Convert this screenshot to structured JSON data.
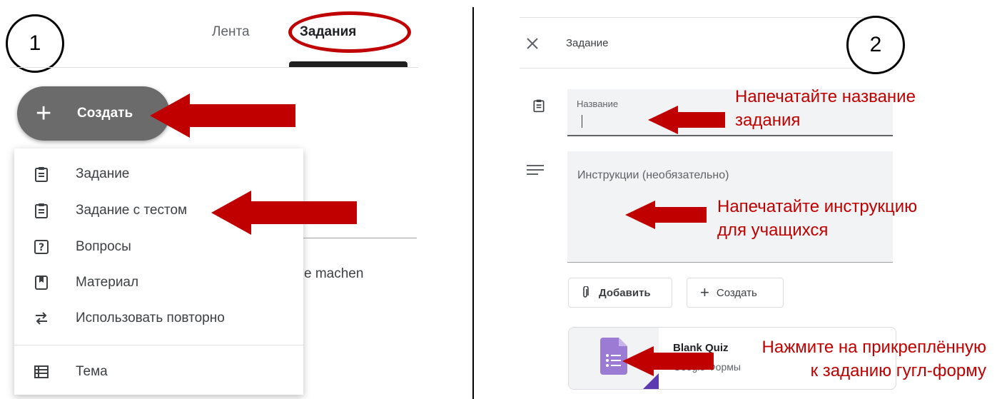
{
  "left": {
    "step_number": "1",
    "tabs": [
      {
        "label": "Лента"
      },
      {
        "label": "Задания"
      }
    ],
    "create_button": {
      "label": "Создать",
      "icon": "plus-icon"
    },
    "menu": [
      {
        "label": "Задание",
        "icon": "assignment-icon"
      },
      {
        "label": "Задание с тестом",
        "icon": "quiz-assignment-icon"
      },
      {
        "label": "Вопросы",
        "icon": "question-icon"
      },
      {
        "label": "Материал",
        "icon": "material-icon"
      },
      {
        "label": "Использовать повторно",
        "icon": "reuse-icon"
      },
      {
        "label": "Тема",
        "icon": "topic-icon"
      }
    ],
    "background_text": "e machen"
  },
  "right": {
    "step_number": "2",
    "header": {
      "close_icon": "close-icon",
      "title": "Задание"
    },
    "title_field": {
      "label": "Название",
      "icon": "assignment-icon"
    },
    "instructions_field": {
      "placeholder": "Инструкции (необязательно)",
      "icon": "notes-icon"
    },
    "add_button": {
      "label": "Добавить",
      "icon": "paperclip-icon"
    },
    "create_button": {
      "label": "Создать",
      "icon": "plus-icon"
    },
    "attachment": {
      "title": "Blank Quiz",
      "subtitle": "Google Формы",
      "icon": "google-forms-icon"
    },
    "annotations": {
      "title_hint": [
        "Напечатайте название",
        "задания"
      ],
      "instructions_hint": [
        "Напечатайте инструкцию",
        "для учащихся"
      ],
      "attachment_hint": [
        "Нажмите на прикреплённую",
        "к заданию гугл-форму"
      ]
    }
  },
  "colors": {
    "annotation_red": "#c00000",
    "create_button_gray": "#6b6b6b",
    "forms_purple": "#9c7bd4"
  }
}
